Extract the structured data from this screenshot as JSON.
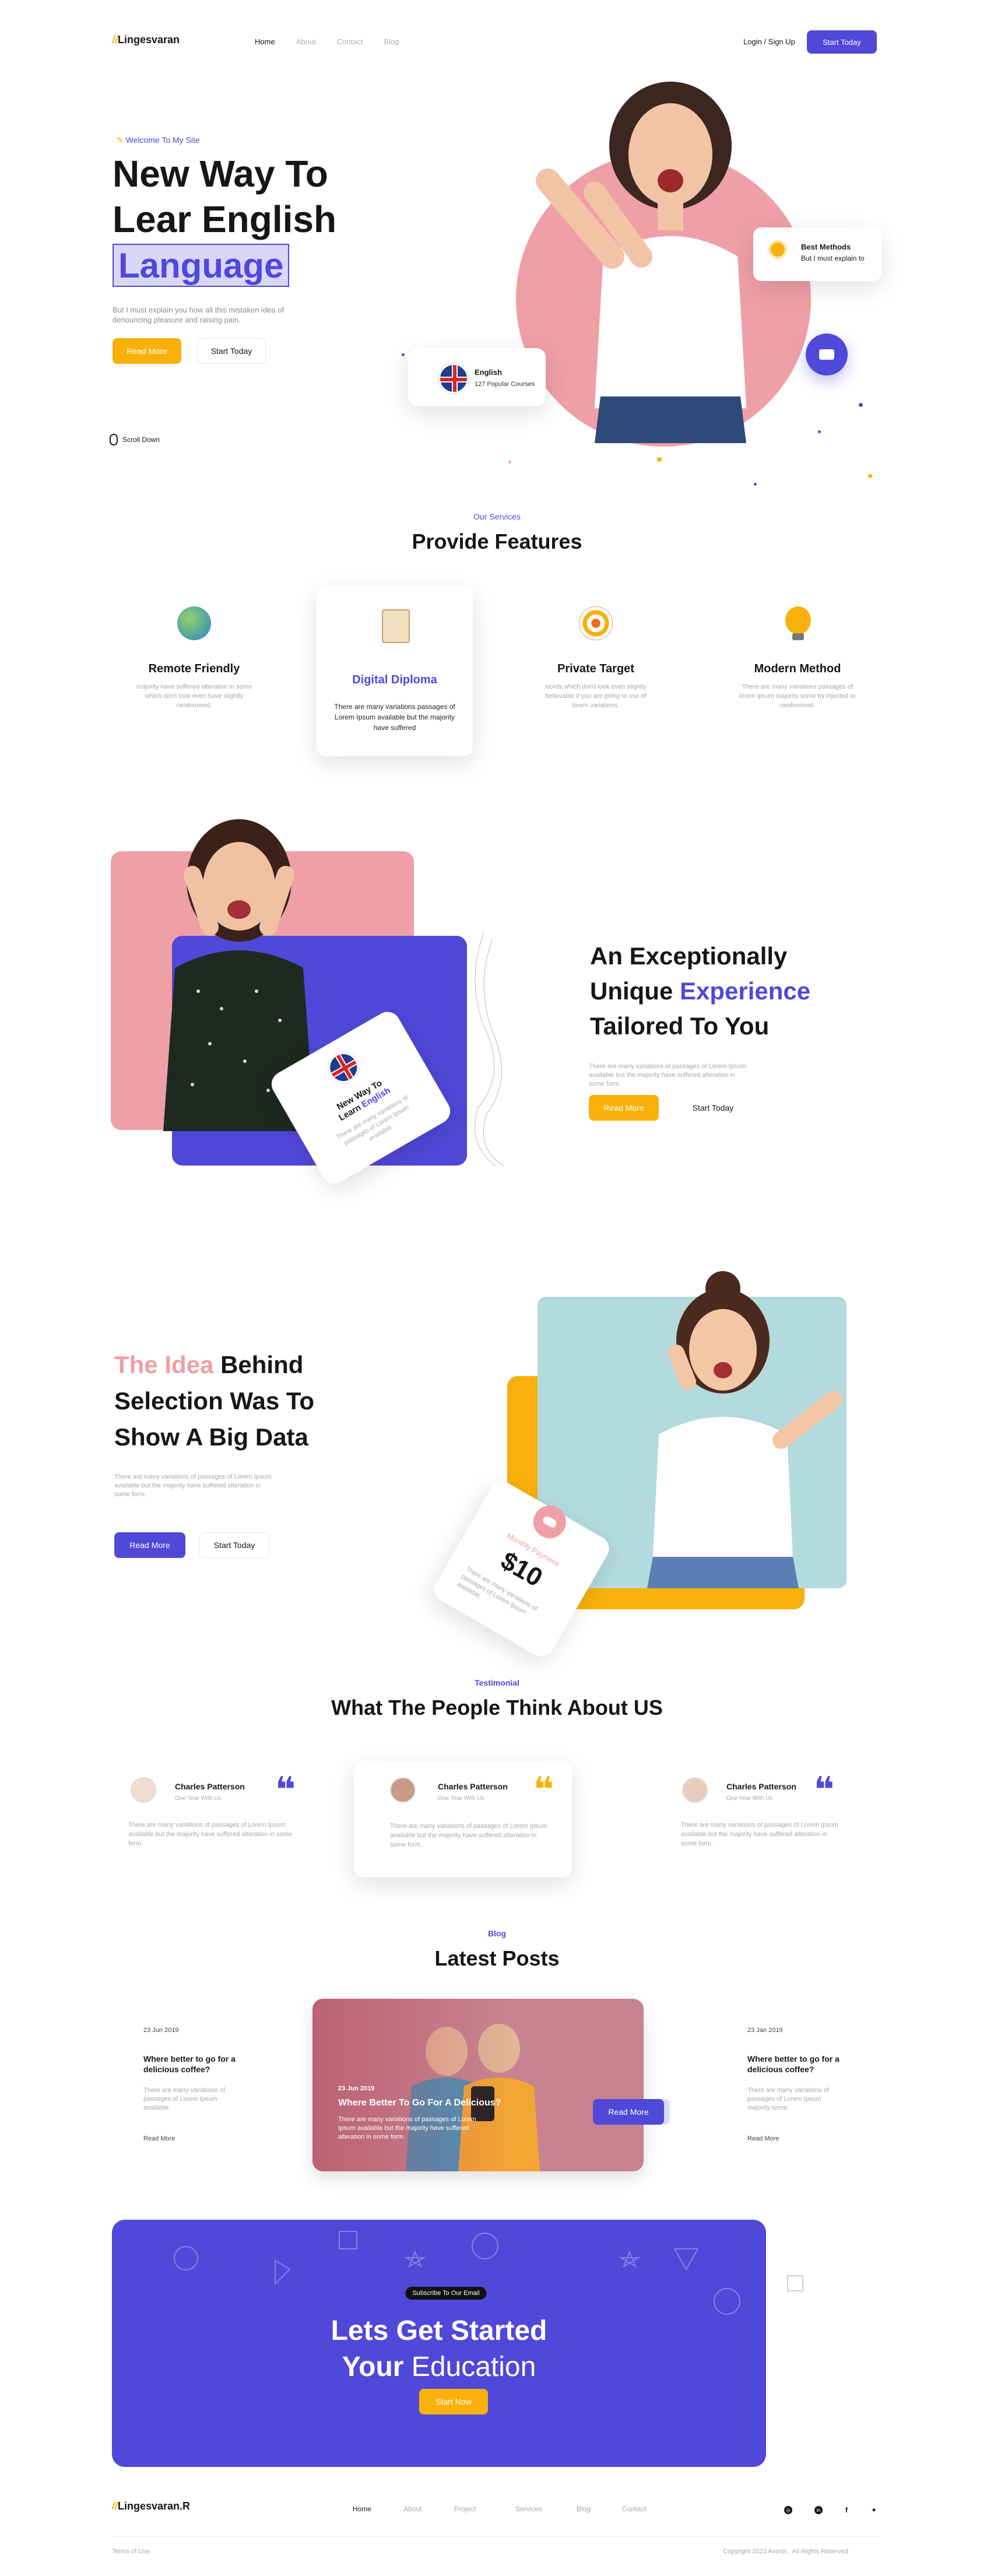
{
  "brand": {
    "logo": "Lingesvaran",
    "footer_logo": "Lingesvaran.R"
  },
  "nav": {
    "items": [
      "Home",
      "About",
      "Contact",
      "Blog"
    ],
    "login": "Login / Sign Up",
    "cta": "Start Today"
  },
  "hero": {
    "welcome": "Welcome To My Site",
    "line1": "New Way To",
    "line2": "Lear English",
    "line3": "Language",
    "desc1": "But I must explain you how all this mistaken idea of",
    "desc2": "denouncing pleasure and raising pain.",
    "read_more": "Read More",
    "start": "Start Today",
    "scroll": "Scroll Down",
    "english_title": "English",
    "english_sub": "127 Popular Courses",
    "best_title": "Best Methods",
    "best_sub": "But I must explain to"
  },
  "services": {
    "eyebrow": "Our Services",
    "title": "Provide Features",
    "items": [
      {
        "title": "Remote Friendly",
        "desc": "majority have suffered alteration in some which don't look even have slightly randomised."
      },
      {
        "title": "Digital Diploma",
        "desc": "There are many variations passages of Lorem Ipsum available but the majority have suffered"
      },
      {
        "title": "Private  Target",
        "desc": "words which don't look even slightly believable if you are going to use of lorem variations."
      },
      {
        "title": "Modern Method",
        "desc": "There are many variations passages of lorem ipsum majority some by injected or randomised."
      }
    ]
  },
  "experience": {
    "line1": "An Exceptionally",
    "line2a": "Unique ",
    "line2b": "Experience",
    "line3": "Tailored To You",
    "desc": "There are many variations of passages of Lorem Ipsum available but the majority have suffered alteration in some form.",
    "read_more": "Read More",
    "start": "Start Today",
    "card_title_a": "New Way To",
    "card_title_b": "Learn ",
    "card_title_c": "English",
    "card_desc": "There are many variations of passages of Lorem Ipsum available."
  },
  "idea": {
    "w1": "The Idea ",
    "w2": "Behind",
    "line2": "Selection Was To",
    "line3": "Show A Big Data",
    "desc": "There are many variations of passages of Lorem Ipsum available but the majority have suffered alteration in some form.",
    "read_more": "Read More",
    "start": "Start Today",
    "card_label": "Monthly Payment",
    "card_price": "$10",
    "card_desc": "There are many variations of passages of Lorem Ipsum available."
  },
  "testimonial": {
    "eyebrow": "Testimonial",
    "title": "What The People Think About US",
    "items": [
      {
        "name": "Charles Patterson",
        "role": "One Year With Us",
        "text": "There are many variations of passages of Lorem Ipsum available but the majority have suffered alteration in some form."
      },
      {
        "name": "Charles Patterson",
        "role": "One Year With Us",
        "text": "There are many variations of passages of Lorem Ipsum available but the majority have suffered alteration in some form."
      },
      {
        "name": "Charles Patterson",
        "role": "One Year With Us",
        "text": "There are many variations of passages of Lorem Ipsum available but the majority have suffered alteration in some form."
      }
    ]
  },
  "blog": {
    "eyebrow": "Blog",
    "title": "Latest Posts",
    "left": {
      "date": "23 Jun 2019",
      "title": "Where better to go for a delicious coffee?",
      "desc": "There are many variations of passages of Lorem Ipsum available.",
      "link": "Read More"
    },
    "center": {
      "date": "23 Jun 2019",
      "title": "Where  Better To Go For A Delicious?",
      "desc": "There are many variations of passages of Lorem Ipsum available but the majority have suffered alteration in some form.",
      "button": "Read More"
    },
    "right": {
      "date": "23 Jan 2019",
      "title": "Where better to go for a delicious coffee?",
      "desc": "There are many variations of passages of Lorem Ipsum majority some.",
      "link": "Read More"
    }
  },
  "cta": {
    "badge": "Subscribe To Our Email",
    "line1": "Lets Get Started",
    "line2a": "Your ",
    "line2b": "Education",
    "button": "Start Now"
  },
  "footer": {
    "links": [
      "Home",
      "About",
      "Project",
      "Services",
      "Blog",
      "Contact"
    ],
    "terms": "Terms of Use",
    "copyright": "Copyright 2023 Avenix . All Rights Reserved"
  },
  "colors": {
    "primary": "#5048d8",
    "yellow": "#f7b10a",
    "pink": "#ef9fa6",
    "teal": "#b3dadd"
  }
}
